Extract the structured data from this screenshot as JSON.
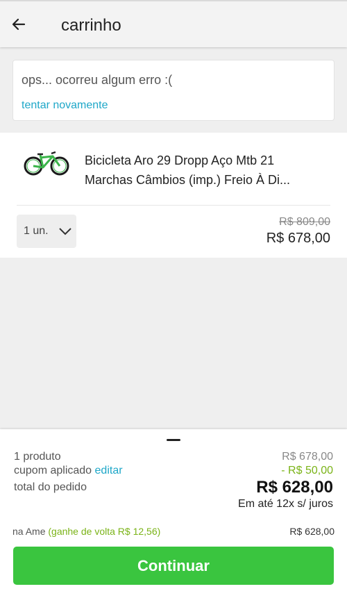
{
  "header": {
    "title": "carrinho",
    "back_icon": "arrow-left-icon"
  },
  "error": {
    "message": "ops... ocorreu algum erro :(",
    "retry_label": "tentar novamente"
  },
  "product": {
    "name_line1": "Bicicleta Aro 29 Dropp Aço Mtb 21",
    "name_line2": "Marchas Câmbios (imp.) Freio À Di...",
    "quantity": "1 un.",
    "old_price": "R$ 809,00",
    "price": "R$ 678,00"
  },
  "summary": {
    "products_label": "1 produto",
    "products_value": "R$ 678,00",
    "coupon_label": "cupom aplicado",
    "coupon_edit": "editar",
    "coupon_value": "- R$ 50,00",
    "total_label": "total do pedido",
    "total_value": "R$ 628,00",
    "installments": "Em até 12x s/ juros",
    "ame_label": "na Ame",
    "ame_cashback": "(ganhe de volta R$ 12,56)",
    "ame_value": "R$ 628,00",
    "continue_label": "Continuar"
  },
  "colors": {
    "accent_blue": "#1ea7c8",
    "green_button": "#3ac53f",
    "green_text": "#7ab317"
  }
}
